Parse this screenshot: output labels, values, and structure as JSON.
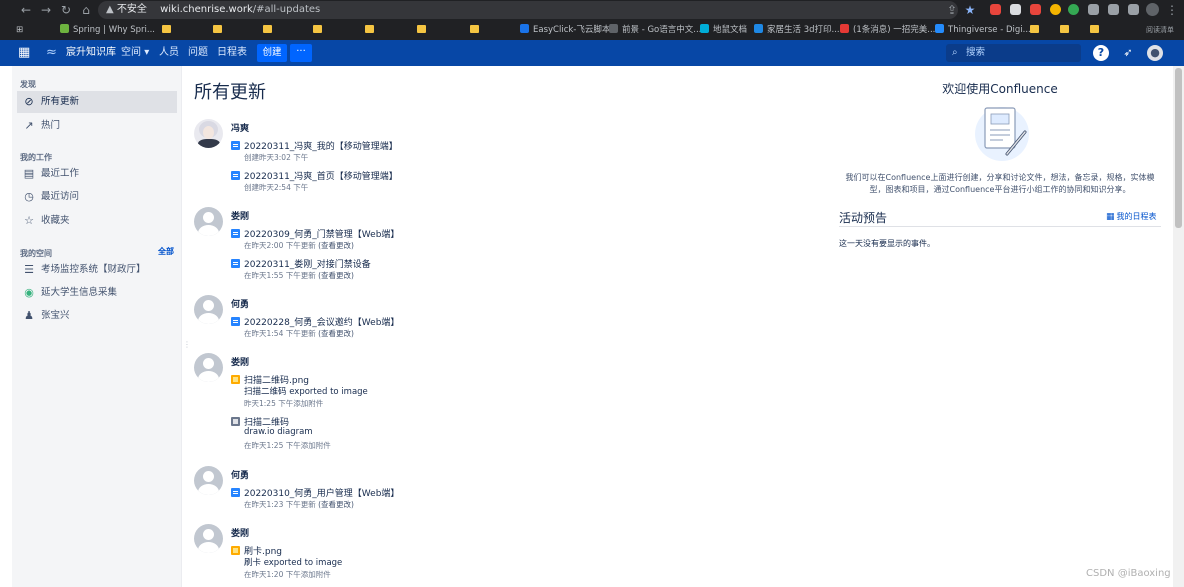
{
  "browser": {
    "security_label": "不安全",
    "url_host": "wiki.chenrise.work",
    "url_path": "/#all-updates",
    "bookmarks": [
      {
        "label": "Spring | Why Spri...",
        "color": "#6db33f"
      },
      {
        "label": "EasyClick-飞云脚本",
        "color": "#1a73e8"
      },
      {
        "label": "前景 - Go语言中文...",
        "color": "#5f6368"
      },
      {
        "label": "地鼠文档",
        "color": "#00add8"
      },
      {
        "label": "家居生活 3d打印...",
        "color": "#1e88e5"
      },
      {
        "label": "(1条消息) 一招完美...",
        "color": "#e53935"
      },
      {
        "label": "Thingiverse - Digi...",
        "color": "#248bfb"
      }
    ],
    "reading_list": "阅读清单"
  },
  "header": {
    "brand": "宸升知识库",
    "nav": [
      "空间",
      "人员",
      "问题",
      "日程表"
    ],
    "create_label": "创建",
    "more_label": "···",
    "search_placeholder": "搜索",
    "accent": "#0747a6"
  },
  "sidebar": {
    "discover_title": "发现",
    "discover_items": [
      {
        "label": "所有更新",
        "icon": "compass-icon",
        "active": true
      },
      {
        "label": "热门",
        "icon": "trend-icon",
        "active": false
      }
    ],
    "mywork_title": "我的工作",
    "mywork_items": [
      {
        "label": "最近工作",
        "icon": "doc-icon"
      },
      {
        "label": "最近访问",
        "icon": "clock-icon"
      },
      {
        "label": "收藏夹",
        "icon": "star-icon"
      }
    ],
    "spaces_title": "我的空间",
    "spaces_all": "全部",
    "spaces": [
      {
        "label": "考场监控系统【财政厅】"
      },
      {
        "label": "延大学生信息采集"
      },
      {
        "label": "张宝兴"
      }
    ]
  },
  "main": {
    "title": "所有更新",
    "groups": [
      {
        "user": "冯爽",
        "entries": [
          {
            "type": "page",
            "title": "20220311_冯爽_我的【移动管理端】",
            "meta": "创建昨天3:02 下午"
          },
          {
            "type": "page",
            "title": "20220311_冯爽_首页【移动管理端】",
            "meta": "创建昨天2:54 下午"
          }
        ]
      },
      {
        "user": "娄刚",
        "entries": [
          {
            "type": "page",
            "title": "20220309_何勇_门禁管理【Web端】",
            "meta": "在昨天2:00 下午更新",
            "link": "(查看更改)"
          },
          {
            "type": "page",
            "title": "20220311_娄刚_对接门禁设备",
            "meta": "在昨天1:55 下午更新",
            "link": "(查看更改)"
          }
        ]
      },
      {
        "user": "何勇",
        "entries": [
          {
            "type": "page",
            "title": "20220228_何勇_会议邀约【Web端】",
            "meta": "在昨天1:54 下午更新",
            "link": "(查看更改)"
          }
        ]
      },
      {
        "user": "娄刚",
        "entries": [
          {
            "type": "image",
            "title": "扫描二维码.png",
            "sub": "扫描二维码 exported to image",
            "meta": "昨天1:25 下午添加附件"
          },
          {
            "type": "diagram",
            "title": "扫描二维码",
            "sub": "draw.io diagram",
            "meta": "在昨天1:25 下午添加附件"
          }
        ]
      },
      {
        "user": "何勇",
        "entries": [
          {
            "type": "page",
            "title": "20220310_何勇_用户管理【Web端】",
            "meta": "在昨天1:23 下午更新",
            "link": "(查看更改)"
          }
        ]
      },
      {
        "user": "娄刚",
        "entries": [
          {
            "type": "image",
            "title": "刷卡.png",
            "sub": "刷卡 exported to image",
            "meta": "在昨天1:20 下午添加附件"
          }
        ]
      }
    ]
  },
  "right": {
    "welcome_title": "欢迎使用Confluence",
    "welcome_desc": "我们可以在Confluence上面进行创建，分享和讨论文件，想法，备忘录，规格，实体模型，图表和项目，通过Confluence平台进行小组工作的协同和知识分享。",
    "events_title": "活动预告",
    "calendar_link": "我的日程表",
    "events_empty": "这一天没有要显示的事件。"
  },
  "watermark": "CSDN @iBaoxing"
}
